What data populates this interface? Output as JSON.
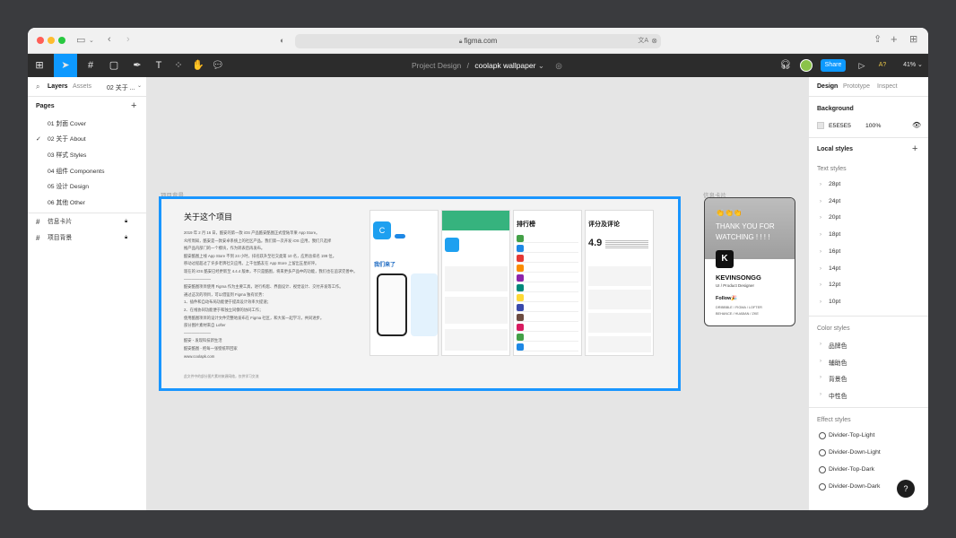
{
  "browser": {
    "url": "figma.com"
  },
  "toolbar": {
    "project": "Project Design",
    "separator": "/",
    "file": "coolapk wallpaper",
    "share_label": "Share",
    "zoom": "41%"
  },
  "left_panel": {
    "tabs": [
      "Layers",
      "Assets"
    ],
    "current_page_short": "02 关于 ...",
    "pages_title": "Pages",
    "pages": [
      "01 封面 Cover",
      "02 关于 About",
      "03 样式 Styles",
      "04 组件 Components",
      "05 设计 Design",
      "06 其他 Other"
    ],
    "layers": [
      "信息卡片",
      "项目背景"
    ]
  },
  "right_panel": {
    "tabs": [
      "Design",
      "Prototype",
      "Inspect"
    ],
    "background_title": "Background",
    "bg_hex": "E5E5E5",
    "bg_opacity": "100%",
    "local_styles_title": "Local styles",
    "text_styles_title": "Text styles",
    "text_styles": [
      "28pt",
      "24pt",
      "20pt",
      "18pt",
      "16pt",
      "14pt",
      "12pt",
      "10pt"
    ],
    "color_styles_title": "Color styles",
    "color_styles": [
      "品牌色",
      "辅助色",
      "背景色",
      "中性色"
    ],
    "effect_styles_title": "Effect styles",
    "effect_styles": [
      "Divider-Top-Light",
      "Divider-Down-Light",
      "Divider-Top-Dark",
      "Divider-Down-Dark"
    ]
  },
  "canvas": {
    "frame1_label": "项目背景",
    "frame2_label": "信息卡片",
    "doc_title": "关于这个项目",
    "doc_lines": [
      "2019 年 2 月 16 日，酷安的第一款 iOS 产品酷安酷图正式登陆苹果 App Store。",
      "众所周知，酷安是一款安卓系统上的社区产品。我们第一次开发 iOS 应用，我们只选择",
      "推产品内部门的一个模块，作为转表后再发布。",
      "酷安酷图上线 App Store 不到 24 小时，排名跃升至社交类第 10 名，应用总排名 199 位。",
      "移动过程超过了许多老牌社交应用。上千位酷友在 App Store 上留出五星好评。",
      "现在的 iOS 酷安已经更新至 4.4.4 版本，不只是酷图，将来更多产品中的功能，我们也在追求完善中。",
      "———————",
      "酷安酷图项目使用 Figma 作为主要工具，进行构思、界面设计、视觉设计、交付开发等工作。",
      "通过这次的项目，可以借鉴到 Figma 独有优势：",
      "1、插件和自动布局功能便于提高设计效率大提速；",
      "2、在线协同功能便于和独立同僚的协同工作；",
      "使用酷图项目的设计文件完整地发布在 Figma 社区，和大家一起学习，共同进步。",
      "部分图片素材来自 Lofter",
      "———————",
      "酷安 - 发现科技新生活",
      "酷安酷图 - 把每一张壁纸带回家",
      "www.coolapk.com"
    ],
    "doc_footer": "此文件中的部分图片素材来源网络，仅供学习交流",
    "shot_titles": [
      "排行榜",
      "评分及评论"
    ],
    "rating_value": "4.9",
    "store_promo": "我们来了",
    "card": {
      "emoji": "👏👏👏",
      "thanks": "THANK YOU FOR WATCHING ! ! ! !",
      "name": "KEVINSONGG",
      "role": "UI / Product Designer",
      "follow": "Follow🎉",
      "links1": "DRIBBBLE / FIGMA / LOFTER",
      "links2": "BEHANCE / HUABAN / ZKE"
    }
  },
  "colors": {
    "accent": "#0d99ff",
    "selection": "#1996ff",
    "canvas_bg": "#e5e5e5",
    "app_green": "#36b37e"
  }
}
